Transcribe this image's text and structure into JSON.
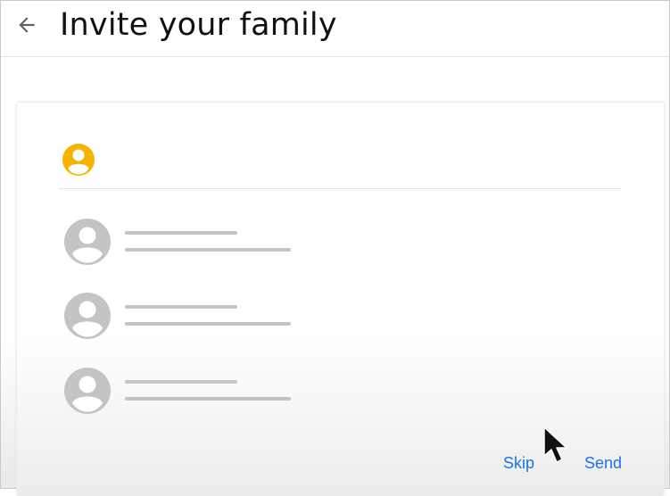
{
  "header": {
    "title": "Invite your family",
    "back_icon": "arrow-left-icon"
  },
  "owner": {
    "avatar_icon": "account-circle-icon",
    "avatar_color": "#f2b400"
  },
  "members": {
    "placeholder_avatar_icon": "account-circle-icon",
    "placeholder_color": "#c4c4c4",
    "count": 3
  },
  "actions": {
    "skip_label": "Skip",
    "send_label": "Send",
    "link_color": "#1a73e8"
  },
  "pointer": {
    "icon": "mouse-pointer-icon"
  }
}
